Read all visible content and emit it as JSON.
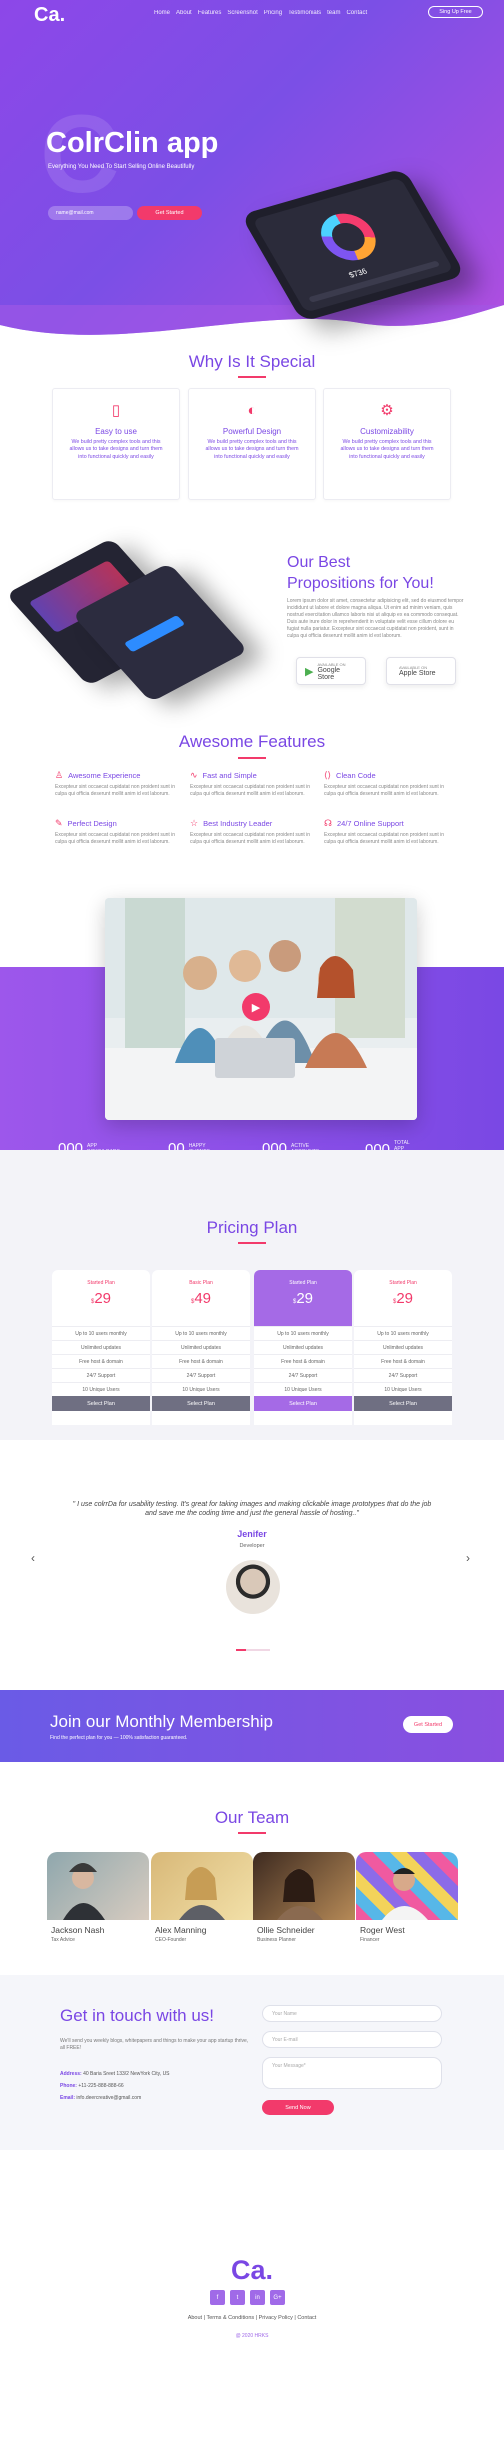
{
  "header": {
    "logo": "Ca.",
    "nav": [
      "Home",
      "About",
      "Features",
      "Screenshot",
      "Pricing",
      "Testimonials",
      "team",
      "Contact"
    ],
    "signup_label": "Sing Up Free"
  },
  "hero": {
    "watermark": "C",
    "title": "ColrClin app",
    "subtitle": "Everything You Need To Start Selling Online Beautifully",
    "email_placeholder": "name@mail.com",
    "cta_label": "Get Started",
    "phone_amount": "$736"
  },
  "why": {
    "title": "Why Is It Special",
    "cards": [
      {
        "icon": "phone-icon",
        "title": "Easy to use",
        "text": "We build pretty complex tools and this allows us to take designs and turn them into functional quickly and easily"
      },
      {
        "icon": "palette-icon",
        "title": "Powerful Design",
        "text": "We build pretty complex tools and this allows us to take designs and turn them into functional quickly and easily"
      },
      {
        "icon": "settings-icon",
        "title": "Customizability",
        "text": "We build pretty complex tools and this allows us to take designs and turn them into functional quickly and easily"
      }
    ]
  },
  "propositions": {
    "title_line1": "Our Best",
    "title_line2": "Propositions for You!",
    "text": "Lorem ipsum dolor sit amet, consectetur adipisicing elit, sed do eiusmod tempor incididunt ut labore et dolore magna aliqua. Ut enim ad minim veniam, quis nostrud exercitation ullamco laboris nisi ut aliquip ex ea commodo consequat. Duis aute irure dolor in reprehenderit in voluptate velit esse cillum dolore eu fugiat nulla pariatur. Excepteur sint occaecat cupidatat non proident, sunt in culpa qui officia deserunt mollit anim id est laborum.",
    "google": {
      "small": "AVAILABLE ON",
      "big": "Google Store"
    },
    "apple": {
      "small": "AVAILABLE ON",
      "big": "Apple Store"
    }
  },
  "features": {
    "title": "Awesome Features",
    "items": [
      {
        "icon": "user-icon",
        "title": "Awesome Experience",
        "text": "Excepteur sint occaecat cupidatat non proident sunt in culpa qui officia deserunt mollit anim id est laborum."
      },
      {
        "icon": "pulse-icon",
        "title": "Fast and Simple",
        "text": "Excepteur sint occaecat cupidatat non proident sunt in culpa qui officia deserunt mollit anim id est laborum."
      },
      {
        "icon": "code-icon",
        "title": "Clean Code",
        "text": "Excepteur sint occaecat cupidatat non proident sunt in culpa qui officia deserunt mollit anim id est laborum."
      },
      {
        "icon": "design-icon",
        "title": "Perfect Design",
        "text": "Excepteur sint occaecat cupidatat non proident sunt in culpa qui officia deserunt mollit anim id est laborum."
      },
      {
        "icon": "star-icon",
        "title": "Best Industry Leader",
        "text": "Excepteur sint occaecat cupidatat non proident sunt in culpa qui officia deserunt mollit anim id est laborum."
      },
      {
        "icon": "headset-icon",
        "title": "24/7 Online Support",
        "text": "Excepteur sint occaecat cupidatat non proident sunt in culpa qui officia deserunt mollit anim id est laborum."
      }
    ]
  },
  "stats": [
    {
      "value": "000",
      "label": "APP DOWNLOADS"
    },
    {
      "value": "00",
      "label": "HAPPY CLIENTS"
    },
    {
      "value": "000",
      "label": "ACTIVE ACCOUNTS"
    },
    {
      "value": "000",
      "label": "TOTAL APP RATES"
    }
  ],
  "pricing": {
    "title": "Pricing Plan",
    "plans": [
      {
        "name": "Started Plan",
        "currency": "$",
        "price": "29",
        "features": [
          "Up to 10 users monthly",
          "Unlimited updates",
          "Free host & domain",
          "24/7 Support",
          "10 Unique Users"
        ],
        "button": "Select Plan"
      },
      {
        "name": "Basic Plan",
        "currency": "$",
        "price": "49",
        "features": [
          "Up to 10 users monthly",
          "Unlimited updates",
          "Free host & domain",
          "24/7 Support",
          "10 Unique Users"
        ],
        "button": "Select Plan"
      },
      {
        "name": "Started Plan",
        "currency": "$",
        "price": "29",
        "features": [
          "Up to 10 users monthly",
          "Unlimited updates",
          "Free host & domain",
          "24/7 Support",
          "10 Unique Users"
        ],
        "button": "Select Plan"
      },
      {
        "name": "Started Plan",
        "currency": "$",
        "price": "29",
        "features": [
          "Up to 10 users monthly",
          "Unlimited updates",
          "Free host & domain",
          "24/7 Support",
          "10 Unique Users"
        ],
        "button": "Select Plan"
      }
    ]
  },
  "testimonial": {
    "quote": "\" I use colrrDa for usability testing. It's great for taking images and making clickable image prototypes that do the job and save me the coding time and just the general hassle of hosting..\"",
    "name": "Jenifer",
    "role": "Developer",
    "prev": "‹",
    "next": "›"
  },
  "membership": {
    "title": "Join our Monthly Membership",
    "subtitle": "Find the perfect plan for you — 100% satisfaction guaranteed.",
    "button": "Get Started"
  },
  "team": {
    "title": "Our Team",
    "members": [
      {
        "name": "Jackson Nash",
        "role": "Tax Advice"
      },
      {
        "name": "Alex Manning",
        "role": "CEO-Founder"
      },
      {
        "name": "Ollie Schneider",
        "role": "Business Planner"
      },
      {
        "name": "Roger West",
        "role": "Financer"
      }
    ]
  },
  "contact": {
    "title": "Get in touch with us!",
    "text": "We'll send you weekly blogs, whitepapers and things to make your app startup thrive, all FREE!",
    "address_label": "Address:",
    "address": "40 Baria Sreet 133/2 NewYork City, US",
    "phone_label": "Phone:",
    "phone": "+11-225-888-888-66",
    "email_label": "Email:",
    "email": "info.deercreative@gmail.com",
    "name_placeholder": "Your Name",
    "email_placeholder": "Your E-mail",
    "message_placeholder": "Your Message*",
    "send_label": "Send Now"
  },
  "footer": {
    "logo": "Ca.",
    "social": [
      "f",
      "t",
      "in",
      "G+"
    ],
    "links": "About | Terms & Conditions | Privacy Policy | Contact",
    "copyright": "@ 2020 HRKS"
  }
}
